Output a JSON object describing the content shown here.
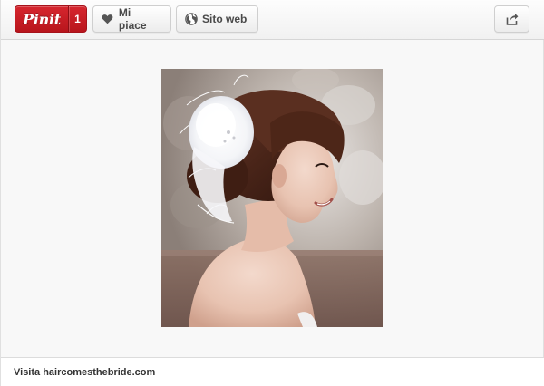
{
  "toolbar": {
    "pinit_label": "Pinit",
    "pinit_count": "1",
    "like_label": "Mi piace",
    "like_icon": "heart-icon",
    "website_label": "Sito web",
    "website_icon": "globe-icon",
    "share_icon": "share-icon"
  },
  "pin": {
    "image_alt": "bride-photo"
  },
  "footer": {
    "visit_label": "Visita haircomesthebride.com"
  },
  "colors": {
    "pinit_red": "#c8161d",
    "background": "#f8f8f8"
  }
}
